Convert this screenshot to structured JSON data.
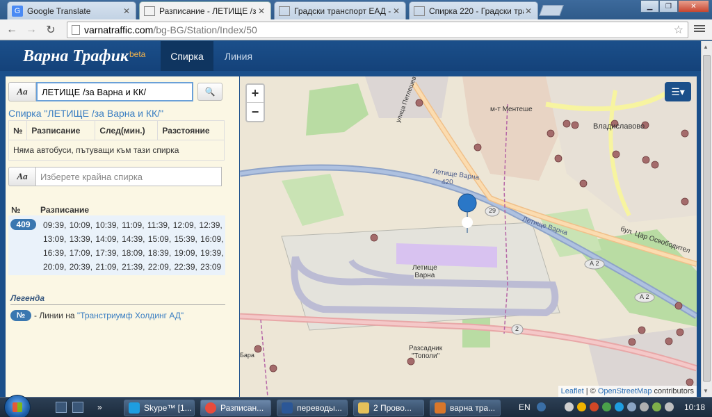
{
  "browser": {
    "tabs": [
      {
        "title": "Google Translate",
        "icon": "google-translate-icon",
        "active": false
      },
      {
        "title": "Разписание - ЛЕТИЩЕ /з",
        "icon": "page-icon",
        "active": true
      },
      {
        "title": "Градски транспорт ЕАД -",
        "icon": "page-icon",
        "active": false
      },
      {
        "title": "Спирка 220 - Градски тра",
        "icon": "page-icon",
        "active": false
      }
    ],
    "url_host": "varnatraffic.com",
    "url_path": "/bg-BG/Station/Index/50"
  },
  "site": {
    "logo": "Варна Трафик",
    "beta": "beta",
    "nav": [
      {
        "label": "Спирка",
        "active": true
      },
      {
        "label": "Линия",
        "active": false
      }
    ]
  },
  "sidebar": {
    "aa_label": "Aa",
    "station_input_value": "ЛЕТИЩЕ /за Варна и КК/",
    "station_title": "Спирка \"ЛЕТИЩЕ /за Варна и КК/\"",
    "table_headers": [
      "№",
      "Разписание",
      "След(мин.)",
      "Разстояние"
    ],
    "no_buses_text": "Няма автобуси, пътуващи към тази спирка",
    "end_stop_placeholder": "Изберете крайна спирка",
    "schedule_headers": [
      "№",
      "Разписание"
    ],
    "schedule": [
      {
        "line": "409",
        "times": "09:39, 10:09, 10:39, 11:09, 11:39, 12:09, 12:39, 13:09, 13:39, 14:09, 14:39, 15:09, 15:39, 16:09, 16:39, 17:09, 17:39, 18:09, 18:39, 19:09, 19:39, 20:09, 20:39, 21:09, 21:39, 22:09, 22:39, 23:09"
      }
    ],
    "legend_title": "Легенда",
    "legend_badge": "№",
    "legend_text": " - Линии на ",
    "legend_link": "\"Транстриумф Холдинг АД\""
  },
  "map": {
    "zoom_in": "+",
    "zoom_out": "−",
    "labels": {
      "a": "Летище Варна",
      "b": "420",
      "c": "м-т Ментеше",
      "d": "Владиславово",
      "e": "Летище\nВарна",
      "f": "бул. Цар Освободител",
      "g": "Летище Варна",
      "h": "Разсадник\n\"Тополи\"",
      "i": "А 2",
      "j": "29",
      "k": "2",
      "l": "улица Петлешев",
      "m": "Бара"
    },
    "attribution_leaflet": "Leaflet",
    "attribution_sep": " | © ",
    "attribution_osm": "OpenStreetMap",
    "attribution_tail": " contributors"
  },
  "taskbar": {
    "tasks": [
      {
        "label": "Skype™ [1...",
        "color": "#1e9de0"
      },
      {
        "label": "Разписан...",
        "color": "#e94b3c"
      },
      {
        "label": "переводы...",
        "color": "#2b5797"
      },
      {
        "label": "2 Прово...",
        "color": "#e6c15a"
      },
      {
        "label": "варна тра...",
        "color": "#d9772b"
      }
    ],
    "lang": "EN",
    "clock": "10:18"
  }
}
